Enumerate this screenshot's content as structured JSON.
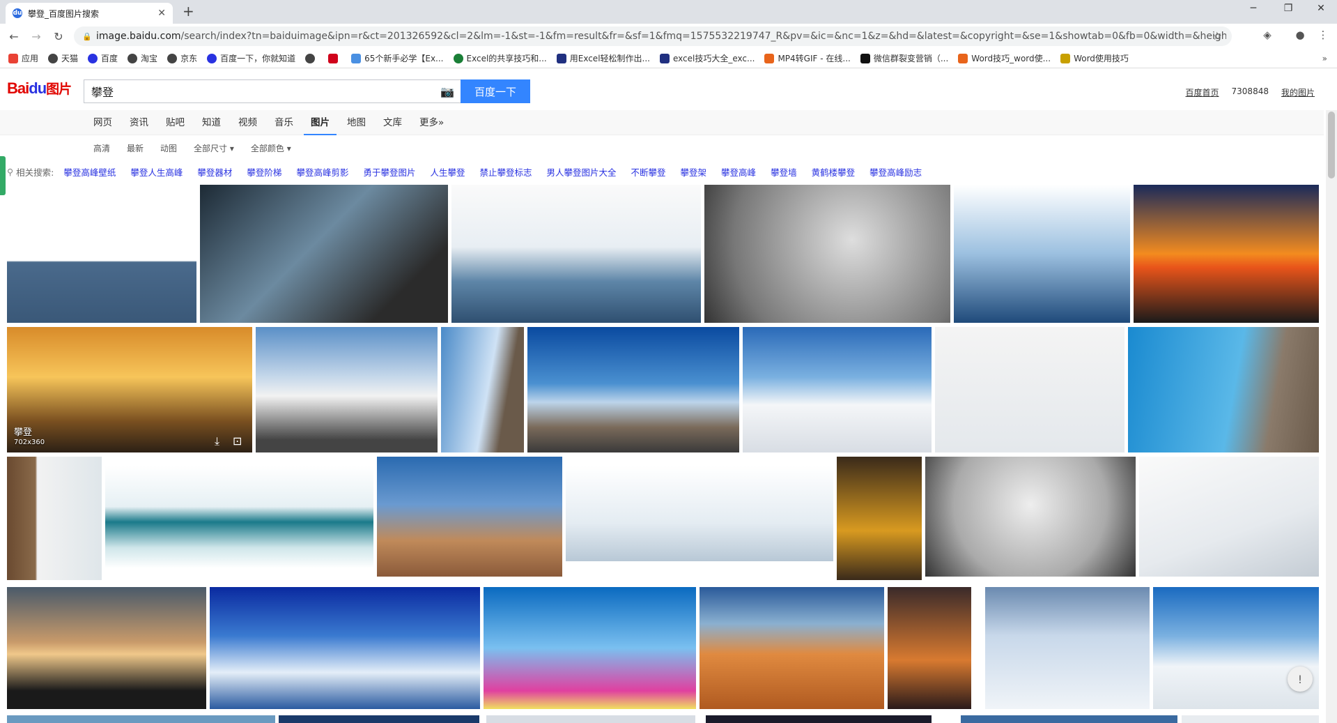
{
  "browser": {
    "tab_title": "攀登_百度图片搜索",
    "url_host": "image.baidu.com",
    "url_path": "/search/index?tn=baiduimage&ipn=r&ct=201326592&cl=2&lm=-1&st=-1&fm=result&fr=&sf=1&fmq=1575532219747_R&pv=&ic=&nc=1&z=&hd=&latest=&copyright=&se=1&showtab=0&fb=0&width=&height=&fa..."
  },
  "bookmarks": [
    {
      "label": "应用",
      "color": "#e94235"
    },
    {
      "label": "天猫",
      "color": "#444444"
    },
    {
      "label": "百度",
      "color": "#2932e1"
    },
    {
      "label": "淘宝",
      "color": "#444444"
    },
    {
      "label": "京东",
      "color": "#444444"
    },
    {
      "label": "百度一下，你就知道",
      "color": "#2932e1"
    },
    {
      "label": "",
      "color": "#444444"
    },
    {
      "label": "",
      "color": "#d0021b"
    },
    {
      "label": "65个新手必学【Ex...",
      "color": "#4a90e2"
    },
    {
      "label": "Excel的共享技巧和...",
      "color": "#1a7f37"
    },
    {
      "label": "用Excel轻松制作出...",
      "color": "#203080"
    },
    {
      "label": "excel技巧大全_exc...",
      "color": "#203080"
    },
    {
      "label": "MP4转GIF - 在线...",
      "color": "#e8641b"
    },
    {
      "label": "微信群裂变营销（...",
      "color": "#111111"
    },
    {
      "label": "Word技巧_word使...",
      "color": "#e8641b"
    },
    {
      "label": "Word使用技巧",
      "color": "#c8a000"
    }
  ],
  "baidu": {
    "logo_bai": "Bai",
    "logo_du": "du",
    "logo_pic": "图片",
    "search_value": "攀登",
    "search_button": "百度一下",
    "top_links": [
      "百度首页",
      "7308848",
      "我的图片"
    ]
  },
  "nav": [
    "网页",
    "资讯",
    "贴吧",
    "知道",
    "视频",
    "音乐",
    "图片",
    "地图",
    "文库",
    "更多»"
  ],
  "nav_active": "图片",
  "filters": [
    "高清",
    "最新",
    "动图",
    "全部尺寸 ▾",
    "全部颜色 ▾"
  ],
  "related_label": "相关搜索:",
  "related": [
    "攀登高峰壁纸",
    "攀登人生高峰",
    "攀登器材",
    "攀登阶梯",
    "攀登高峰剪影",
    "勇于攀登图片",
    "人生攀登",
    "禁止攀登标志",
    "男人攀登图片大全",
    "不断攀登",
    "攀登架",
    "攀登高峰",
    "攀登墙",
    "黄鹤楼攀登",
    "攀登高峰励志"
  ],
  "hover_caption": {
    "title": "攀登",
    "size": "702x360"
  },
  "feedback_icon": "!",
  "colors": {
    "accent": "#3385ff",
    "link": "#2932e1",
    "logo_red": "#e10601"
  }
}
